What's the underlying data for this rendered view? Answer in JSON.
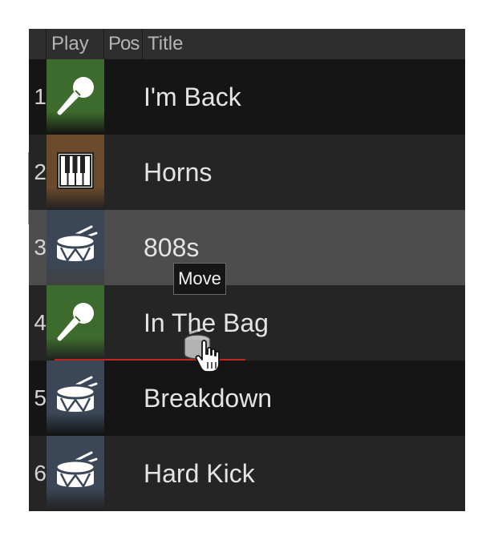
{
  "header": {
    "num": "",
    "play": "Play",
    "pos": "Pos",
    "title": "Title"
  },
  "rows": [
    {
      "num": "1",
      "title": "I'm Back",
      "icon": "microphone-icon",
      "thumb_bg": "#3d6a2d",
      "row_bg": "#151515"
    },
    {
      "num": "2",
      "title": "Horns",
      "icon": "piano-keys-icon",
      "thumb_bg": "#6b4a2c",
      "row_bg": "#252525"
    },
    {
      "num": "3",
      "title": "808s",
      "icon": "drum-icon",
      "thumb_bg": "#3b4656",
      "row_bg": "#4d4d4d"
    },
    {
      "num": "4",
      "title": "In The Bag",
      "icon": "microphone-icon",
      "thumb_bg": "#3d6a2d",
      "row_bg": "#252525"
    },
    {
      "num": "5",
      "title": "Breakdown",
      "icon": "drum-icon",
      "thumb_bg": "#3b4656",
      "row_bg": "#151515"
    },
    {
      "num": "6",
      "title": "Hard Kick",
      "icon": "drum-icon",
      "thumb_bg": "#3b4656",
      "row_bg": "#252525"
    }
  ],
  "drag": {
    "tooltip": "Move",
    "ghost_icon": "drum-icon",
    "cursor": "hand-pointer-icon",
    "dropline_color": "#c0271b"
  }
}
